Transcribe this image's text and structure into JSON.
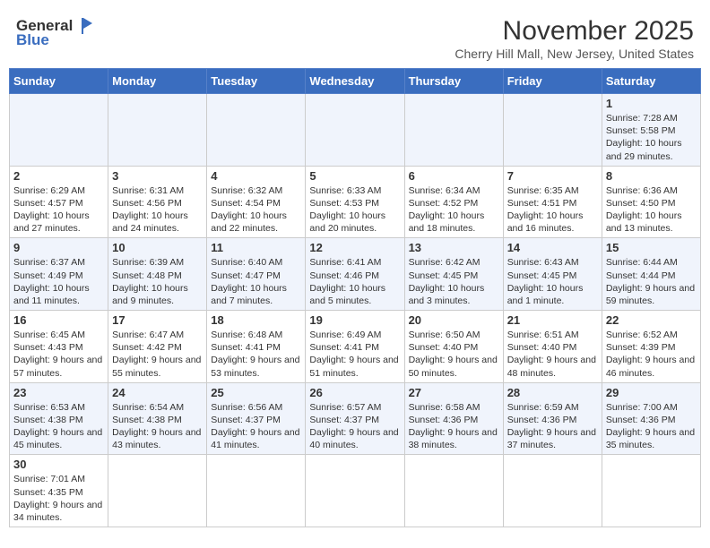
{
  "header": {
    "logo_general": "General",
    "logo_blue": "Blue",
    "month_title": "November 2025",
    "location": "Cherry Hill Mall, New Jersey, United States"
  },
  "weekdays": [
    "Sunday",
    "Monday",
    "Tuesday",
    "Wednesday",
    "Thursday",
    "Friday",
    "Saturday"
  ],
  "weeks": [
    [
      {
        "day": "",
        "info": ""
      },
      {
        "day": "",
        "info": ""
      },
      {
        "day": "",
        "info": ""
      },
      {
        "day": "",
        "info": ""
      },
      {
        "day": "",
        "info": ""
      },
      {
        "day": "",
        "info": ""
      },
      {
        "day": "1",
        "info": "Sunrise: 7:28 AM\nSunset: 5:58 PM\nDaylight: 10 hours and 29 minutes."
      }
    ],
    [
      {
        "day": "2",
        "info": "Sunrise: 6:29 AM\nSunset: 4:57 PM\nDaylight: 10 hours and 27 minutes."
      },
      {
        "day": "3",
        "info": "Sunrise: 6:31 AM\nSunset: 4:56 PM\nDaylight: 10 hours and 24 minutes."
      },
      {
        "day": "4",
        "info": "Sunrise: 6:32 AM\nSunset: 4:54 PM\nDaylight: 10 hours and 22 minutes."
      },
      {
        "day": "5",
        "info": "Sunrise: 6:33 AM\nSunset: 4:53 PM\nDaylight: 10 hours and 20 minutes."
      },
      {
        "day": "6",
        "info": "Sunrise: 6:34 AM\nSunset: 4:52 PM\nDaylight: 10 hours and 18 minutes."
      },
      {
        "day": "7",
        "info": "Sunrise: 6:35 AM\nSunset: 4:51 PM\nDaylight: 10 hours and 16 minutes."
      },
      {
        "day": "8",
        "info": "Sunrise: 6:36 AM\nSunset: 4:50 PM\nDaylight: 10 hours and 13 minutes."
      }
    ],
    [
      {
        "day": "9",
        "info": "Sunrise: 6:37 AM\nSunset: 4:49 PM\nDaylight: 10 hours and 11 minutes."
      },
      {
        "day": "10",
        "info": "Sunrise: 6:39 AM\nSunset: 4:48 PM\nDaylight: 10 hours and 9 minutes."
      },
      {
        "day": "11",
        "info": "Sunrise: 6:40 AM\nSunset: 4:47 PM\nDaylight: 10 hours and 7 minutes."
      },
      {
        "day": "12",
        "info": "Sunrise: 6:41 AM\nSunset: 4:46 PM\nDaylight: 10 hours and 5 minutes."
      },
      {
        "day": "13",
        "info": "Sunrise: 6:42 AM\nSunset: 4:45 PM\nDaylight: 10 hours and 3 minutes."
      },
      {
        "day": "14",
        "info": "Sunrise: 6:43 AM\nSunset: 4:45 PM\nDaylight: 10 hours and 1 minute."
      },
      {
        "day": "15",
        "info": "Sunrise: 6:44 AM\nSunset: 4:44 PM\nDaylight: 9 hours and 59 minutes."
      }
    ],
    [
      {
        "day": "16",
        "info": "Sunrise: 6:45 AM\nSunset: 4:43 PM\nDaylight: 9 hours and 57 minutes."
      },
      {
        "day": "17",
        "info": "Sunrise: 6:47 AM\nSunset: 4:42 PM\nDaylight: 9 hours and 55 minutes."
      },
      {
        "day": "18",
        "info": "Sunrise: 6:48 AM\nSunset: 4:41 PM\nDaylight: 9 hours and 53 minutes."
      },
      {
        "day": "19",
        "info": "Sunrise: 6:49 AM\nSunset: 4:41 PM\nDaylight: 9 hours and 51 minutes."
      },
      {
        "day": "20",
        "info": "Sunrise: 6:50 AM\nSunset: 4:40 PM\nDaylight: 9 hours and 50 minutes."
      },
      {
        "day": "21",
        "info": "Sunrise: 6:51 AM\nSunset: 4:40 PM\nDaylight: 9 hours and 48 minutes."
      },
      {
        "day": "22",
        "info": "Sunrise: 6:52 AM\nSunset: 4:39 PM\nDaylight: 9 hours and 46 minutes."
      }
    ],
    [
      {
        "day": "23",
        "info": "Sunrise: 6:53 AM\nSunset: 4:38 PM\nDaylight: 9 hours and 45 minutes."
      },
      {
        "day": "24",
        "info": "Sunrise: 6:54 AM\nSunset: 4:38 PM\nDaylight: 9 hours and 43 minutes."
      },
      {
        "day": "25",
        "info": "Sunrise: 6:56 AM\nSunset: 4:37 PM\nDaylight: 9 hours and 41 minutes."
      },
      {
        "day": "26",
        "info": "Sunrise: 6:57 AM\nSunset: 4:37 PM\nDaylight: 9 hours and 40 minutes."
      },
      {
        "day": "27",
        "info": "Sunrise: 6:58 AM\nSunset: 4:36 PM\nDaylight: 9 hours and 38 minutes."
      },
      {
        "day": "28",
        "info": "Sunrise: 6:59 AM\nSunset: 4:36 PM\nDaylight: 9 hours and 37 minutes."
      },
      {
        "day": "29",
        "info": "Sunrise: 7:00 AM\nSunset: 4:36 PM\nDaylight: 9 hours and 35 minutes."
      }
    ],
    [
      {
        "day": "30",
        "info": "Sunrise: 7:01 AM\nSunset: 4:35 PM\nDaylight: 9 hours and 34 minutes."
      },
      {
        "day": "",
        "info": ""
      },
      {
        "day": "",
        "info": ""
      },
      {
        "day": "",
        "info": ""
      },
      {
        "day": "",
        "info": ""
      },
      {
        "day": "",
        "info": ""
      },
      {
        "day": "",
        "info": ""
      }
    ]
  ]
}
